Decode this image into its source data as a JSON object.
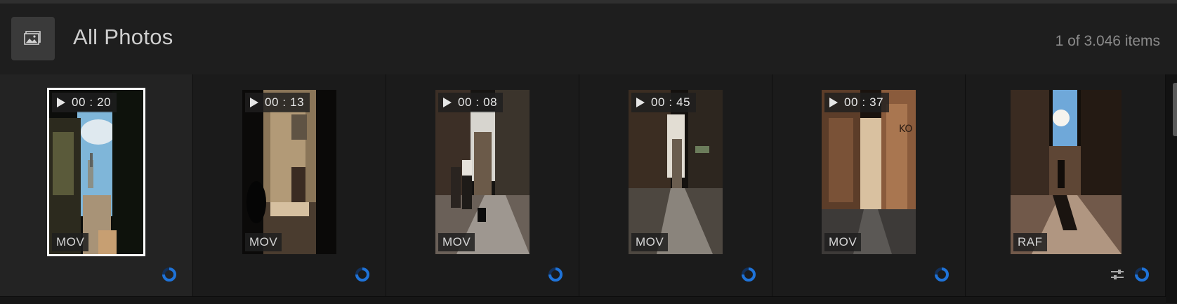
{
  "header": {
    "title": "All Photos",
    "item_count": "1 of 3.046 items",
    "album_icon": "photo-album-icon"
  },
  "colors": {
    "accent": "#1f73d8",
    "selected_border": "#ffffff"
  },
  "items": [
    {
      "duration": "00 : 20",
      "format": "MOV",
      "selected": true,
      "has_play": true
    },
    {
      "duration": "00 : 13",
      "format": "MOV",
      "selected": false,
      "has_play": true
    },
    {
      "duration": "00 : 08",
      "format": "MOV",
      "selected": false,
      "has_play": true
    },
    {
      "duration": "00 : 45",
      "format": "MOV",
      "selected": false,
      "has_play": true
    },
    {
      "duration": "00 : 37",
      "format": "MOV",
      "selected": false,
      "has_play": true
    },
    {
      "duration": "",
      "format": "RAF",
      "selected": false,
      "has_play": false,
      "has_edits": true
    }
  ],
  "icons": {
    "play": "play-icon",
    "sync": "sync-progress-icon",
    "edit": "edit-sliders-icon"
  }
}
